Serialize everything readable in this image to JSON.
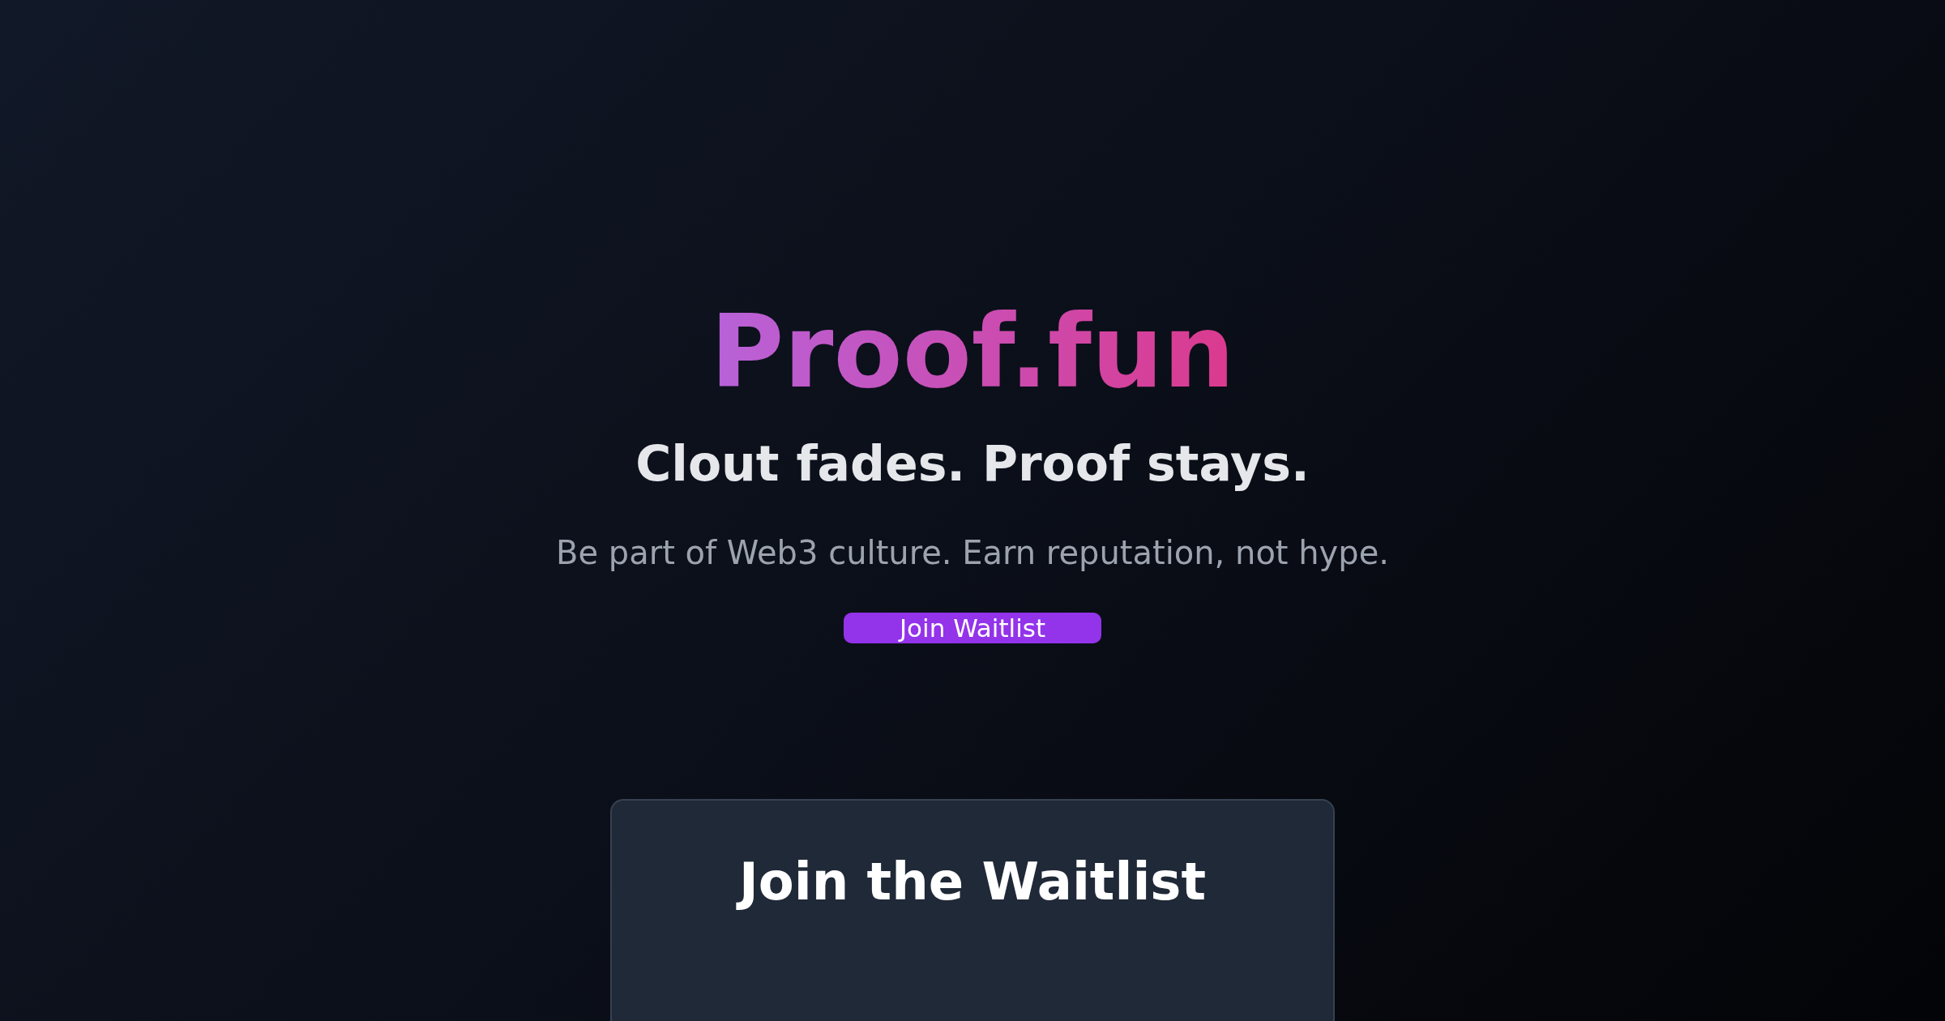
{
  "hero": {
    "title": "Proof.fun",
    "headline": "Clout fades. Proof stays.",
    "tagline": "Be part of Web3 culture. Earn reputation, not hype.",
    "button": "Join Waitlist"
  },
  "waitlist_card": {
    "heading": "Join the Waitlist"
  }
}
